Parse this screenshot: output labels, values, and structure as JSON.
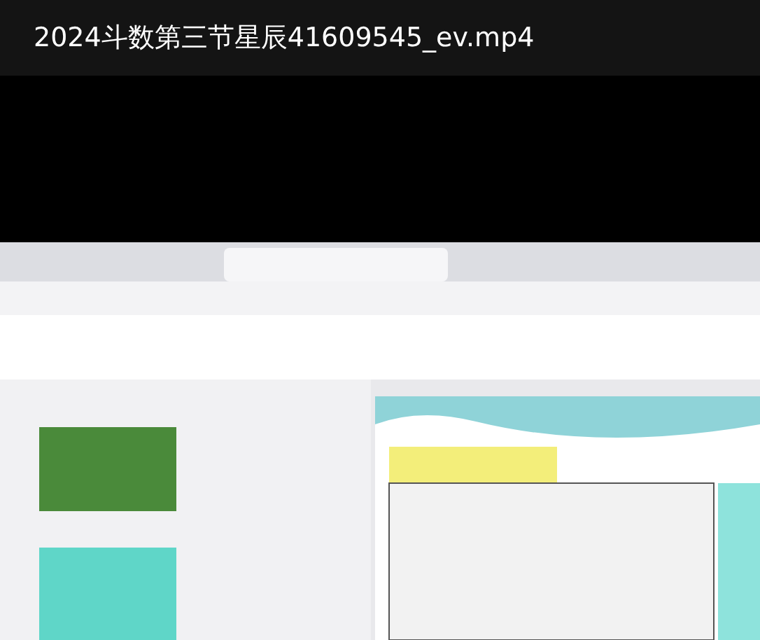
{
  "video": {
    "title": "2024斗数第三节星辰41609545_ev.mp4"
  }
}
